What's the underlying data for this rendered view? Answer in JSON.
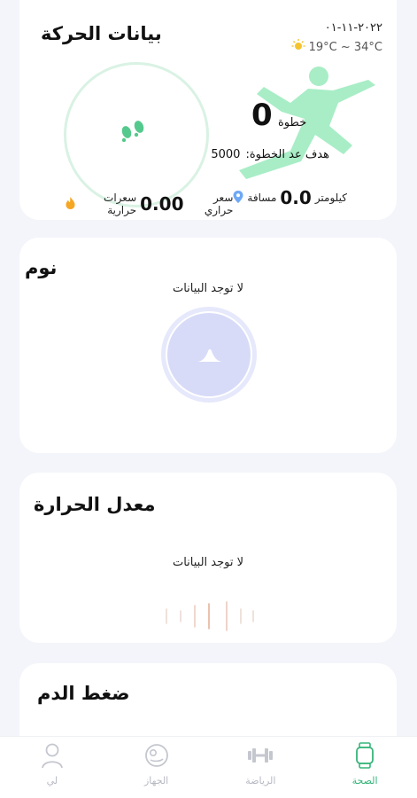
{
  "activity": {
    "title": "بيانات الحركة",
    "date": "٢٠٢٢-١١-٠١",
    "weather_range": "19°C ~ 34°C",
    "steps": "0",
    "steps_unit": "خطوة",
    "goal_label": "هدف عد الخطوة:",
    "goal_value": "5000",
    "distance_value": "0.0",
    "distance_unit": "كيلومتر",
    "distance_label": "مسافة",
    "calories_value": "0.00",
    "calories_unit": "سعر حراري",
    "calories_label": "سعرات حرارية",
    "icons": {
      "weather": "sun-icon",
      "feet": "footprints-icon",
      "runner": "runner-icon"
    }
  },
  "sleep": {
    "title": "نوم",
    "no_data": "لا توجد البيانات",
    "icon": "sleep-hat-icon"
  },
  "heart": {
    "title": "معدل الحرارة",
    "no_data": "لا توجد البيانات"
  },
  "blood_pressure": {
    "title": "ضغط الدم"
  },
  "tabs": [
    {
      "label": "الصحة",
      "icon": "watch-icon",
      "active": true
    },
    {
      "label": "الرياضة",
      "icon": "dumbbell-icon",
      "active": false
    },
    {
      "label": "الجهاز",
      "icon": "device-icon",
      "active": false
    },
    {
      "label": "لي",
      "icon": "person-icon",
      "active": false
    }
  ],
  "colors": {
    "accent_green": "#37b57a",
    "runner_green": "#a8edc6",
    "ring_green": "#d9f2e4",
    "sleep_lilac": "#d7dbf8",
    "background": "#f4f5fa"
  }
}
